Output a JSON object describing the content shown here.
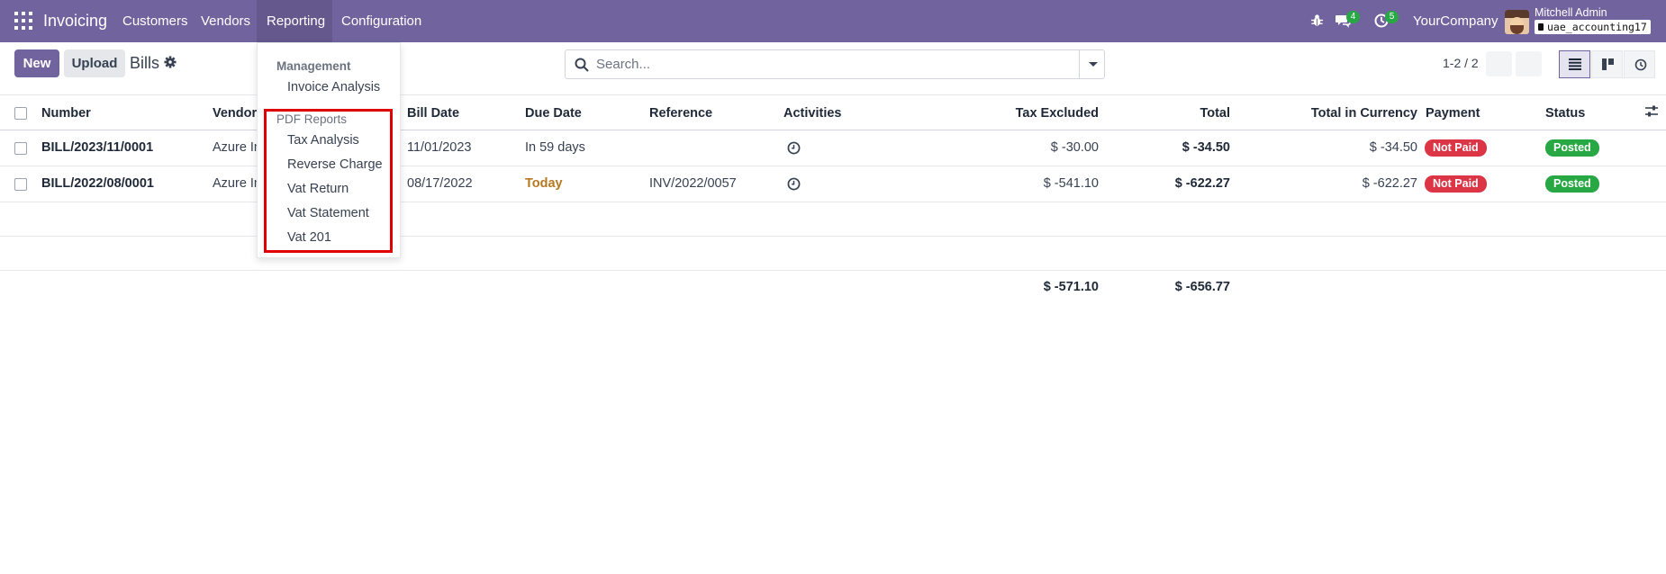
{
  "navbar": {
    "app_name": "Invoicing",
    "menus": [
      "Customers",
      "Vendors",
      "Reporting",
      "Configuration"
    ],
    "messages_count": "4",
    "activities_count": "5",
    "company": "YourCompany",
    "user_name": "Mitchell Admin",
    "database": "uae_accounting17",
    "bar_color": "#71639e"
  },
  "control_panel": {
    "new_label": "New",
    "upload_label": "Upload",
    "breadcrumb": "Bills",
    "search_placeholder": "Search...",
    "pager": "1-2 / 2"
  },
  "table": {
    "columns": [
      "Number",
      "Vendor",
      "Bill Date",
      "Due Date",
      "Reference",
      "Activities",
      "Tax Excluded",
      "Total",
      "Total in Currency",
      "Payment",
      "Status"
    ],
    "rows": [
      {
        "number": "BILL/2023/11/0001",
        "vendor": "Azure In",
        "bill_date": "11/01/2023",
        "due_date": "In 59 days",
        "reference": "",
        "tax_excluded": "$ -30.00",
        "total": "$ -34.50",
        "total_currency": "$ -34.50",
        "payment": "Not Paid",
        "status": "Posted"
      },
      {
        "number": "BILL/2022/08/0001",
        "vendor": "Azure In",
        "bill_date": "08/17/2022",
        "due_date": "Today",
        "reference": "INV/2022/0057",
        "tax_excluded": "$ -541.10",
        "total": "$ -622.27",
        "total_currency": "$ -622.27",
        "payment": "Not Paid",
        "status": "Posted"
      }
    ],
    "totals": {
      "tax_excluded": "$ -571.10",
      "total": "$ -656.77"
    }
  },
  "reporting_menu": {
    "management_header": "Management",
    "management_items": [
      "Invoice Analysis"
    ],
    "pdf_header": "PDF Reports",
    "pdf_items": [
      "Tax Analysis",
      "Reverse Charge",
      "Vat Return",
      "Vat Statement",
      "Vat 201"
    ]
  }
}
